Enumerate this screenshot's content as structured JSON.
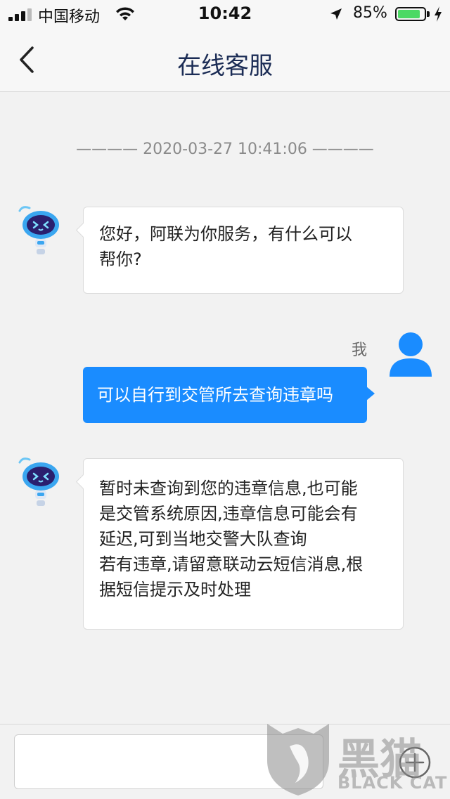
{
  "status_bar": {
    "carrier": "中国移动",
    "time": "10:42",
    "battery_percent": "85%",
    "battery_level": 0.85,
    "icons": [
      "signal-icon",
      "wifi-icon",
      "location-arrow-icon",
      "battery-icon",
      "charging-icon"
    ]
  },
  "nav": {
    "title": "在线客服",
    "back_icon": "chevron-left-icon"
  },
  "chat": {
    "timestamp": "———— 2020-03-27 10:41:06 ————",
    "messages": [
      {
        "from": "bot",
        "avatar": "robot-avatar-icon",
        "lines": [
          "您好，阿联为你服务，有什么可以",
          "帮你?"
        ]
      },
      {
        "from": "user",
        "sender_name": "我",
        "avatar": "user-avatar-icon",
        "text": "可以自行到交管所去查询违章吗"
      },
      {
        "from": "bot",
        "avatar": "robot-avatar-icon",
        "lines": [
          "暂时未查询到您的违章信息,也可能",
          "是交管系统原因,违章信息可能会有",
          "延迟,可到当地交警大队查询",
          "若有违章,请留意联动云短信消息,根",
          "据短信提示及时处理"
        ]
      }
    ]
  },
  "input_bar": {
    "placeholder": "",
    "plus_icon": "plus-icon"
  },
  "watermark": {
    "chinese": "黑猫",
    "english": "BLACK CAT"
  },
  "colors": {
    "accent": "#1a8cff",
    "nav_title": "#1b2c55",
    "background": "#f2f2f2",
    "battery": "#4cd964"
  }
}
